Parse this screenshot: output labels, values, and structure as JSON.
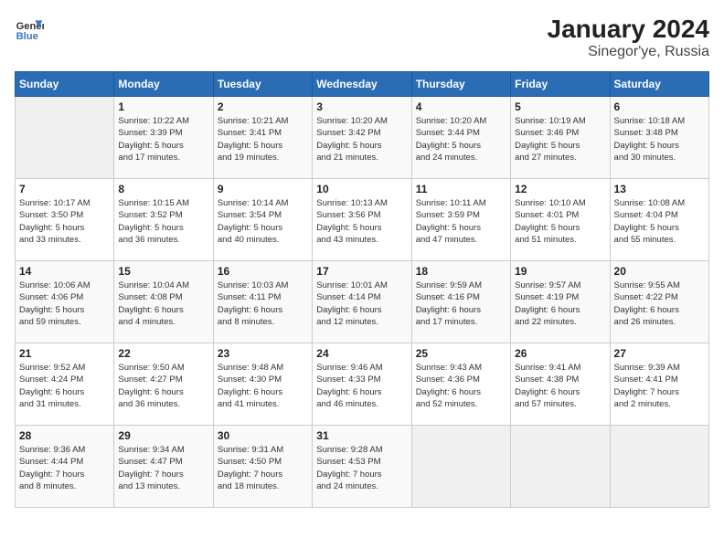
{
  "header": {
    "logo_line1": "General",
    "logo_line2": "Blue",
    "title": "January 2024",
    "subtitle": "Sinegor'ye, Russia"
  },
  "weekdays": [
    "Sunday",
    "Monday",
    "Tuesday",
    "Wednesday",
    "Thursday",
    "Friday",
    "Saturday"
  ],
  "weeks": [
    [
      {
        "day": "",
        "info": ""
      },
      {
        "day": "1",
        "info": "Sunrise: 10:22 AM\nSunset: 3:39 PM\nDaylight: 5 hours\nand 17 minutes."
      },
      {
        "day": "2",
        "info": "Sunrise: 10:21 AM\nSunset: 3:41 PM\nDaylight: 5 hours\nand 19 minutes."
      },
      {
        "day": "3",
        "info": "Sunrise: 10:20 AM\nSunset: 3:42 PM\nDaylight: 5 hours\nand 21 minutes."
      },
      {
        "day": "4",
        "info": "Sunrise: 10:20 AM\nSunset: 3:44 PM\nDaylight: 5 hours\nand 24 minutes."
      },
      {
        "day": "5",
        "info": "Sunrise: 10:19 AM\nSunset: 3:46 PM\nDaylight: 5 hours\nand 27 minutes."
      },
      {
        "day": "6",
        "info": "Sunrise: 10:18 AM\nSunset: 3:48 PM\nDaylight: 5 hours\nand 30 minutes."
      }
    ],
    [
      {
        "day": "7",
        "info": "Sunrise: 10:17 AM\nSunset: 3:50 PM\nDaylight: 5 hours\nand 33 minutes."
      },
      {
        "day": "8",
        "info": "Sunrise: 10:15 AM\nSunset: 3:52 PM\nDaylight: 5 hours\nand 36 minutes."
      },
      {
        "day": "9",
        "info": "Sunrise: 10:14 AM\nSunset: 3:54 PM\nDaylight: 5 hours\nand 40 minutes."
      },
      {
        "day": "10",
        "info": "Sunrise: 10:13 AM\nSunset: 3:56 PM\nDaylight: 5 hours\nand 43 minutes."
      },
      {
        "day": "11",
        "info": "Sunrise: 10:11 AM\nSunset: 3:59 PM\nDaylight: 5 hours\nand 47 minutes."
      },
      {
        "day": "12",
        "info": "Sunrise: 10:10 AM\nSunset: 4:01 PM\nDaylight: 5 hours\nand 51 minutes."
      },
      {
        "day": "13",
        "info": "Sunrise: 10:08 AM\nSunset: 4:04 PM\nDaylight: 5 hours\nand 55 minutes."
      }
    ],
    [
      {
        "day": "14",
        "info": "Sunrise: 10:06 AM\nSunset: 4:06 PM\nDaylight: 5 hours\nand 59 minutes."
      },
      {
        "day": "15",
        "info": "Sunrise: 10:04 AM\nSunset: 4:08 PM\nDaylight: 6 hours\nand 4 minutes."
      },
      {
        "day": "16",
        "info": "Sunrise: 10:03 AM\nSunset: 4:11 PM\nDaylight: 6 hours\nand 8 minutes."
      },
      {
        "day": "17",
        "info": "Sunrise: 10:01 AM\nSunset: 4:14 PM\nDaylight: 6 hours\nand 12 minutes."
      },
      {
        "day": "18",
        "info": "Sunrise: 9:59 AM\nSunset: 4:16 PM\nDaylight: 6 hours\nand 17 minutes."
      },
      {
        "day": "19",
        "info": "Sunrise: 9:57 AM\nSunset: 4:19 PM\nDaylight: 6 hours\nand 22 minutes."
      },
      {
        "day": "20",
        "info": "Sunrise: 9:55 AM\nSunset: 4:22 PM\nDaylight: 6 hours\nand 26 minutes."
      }
    ],
    [
      {
        "day": "21",
        "info": "Sunrise: 9:52 AM\nSunset: 4:24 PM\nDaylight: 6 hours\nand 31 minutes."
      },
      {
        "day": "22",
        "info": "Sunrise: 9:50 AM\nSunset: 4:27 PM\nDaylight: 6 hours\nand 36 minutes."
      },
      {
        "day": "23",
        "info": "Sunrise: 9:48 AM\nSunset: 4:30 PM\nDaylight: 6 hours\nand 41 minutes."
      },
      {
        "day": "24",
        "info": "Sunrise: 9:46 AM\nSunset: 4:33 PM\nDaylight: 6 hours\nand 46 minutes."
      },
      {
        "day": "25",
        "info": "Sunrise: 9:43 AM\nSunset: 4:36 PM\nDaylight: 6 hours\nand 52 minutes."
      },
      {
        "day": "26",
        "info": "Sunrise: 9:41 AM\nSunset: 4:38 PM\nDaylight: 6 hours\nand 57 minutes."
      },
      {
        "day": "27",
        "info": "Sunrise: 9:39 AM\nSunset: 4:41 PM\nDaylight: 7 hours\nand 2 minutes."
      }
    ],
    [
      {
        "day": "28",
        "info": "Sunrise: 9:36 AM\nSunset: 4:44 PM\nDaylight: 7 hours\nand 8 minutes."
      },
      {
        "day": "29",
        "info": "Sunrise: 9:34 AM\nSunset: 4:47 PM\nDaylight: 7 hours\nand 13 minutes."
      },
      {
        "day": "30",
        "info": "Sunrise: 9:31 AM\nSunset: 4:50 PM\nDaylight: 7 hours\nand 18 minutes."
      },
      {
        "day": "31",
        "info": "Sunrise: 9:28 AM\nSunset: 4:53 PM\nDaylight: 7 hours\nand 24 minutes."
      },
      {
        "day": "",
        "info": ""
      },
      {
        "day": "",
        "info": ""
      },
      {
        "day": "",
        "info": ""
      }
    ]
  ]
}
